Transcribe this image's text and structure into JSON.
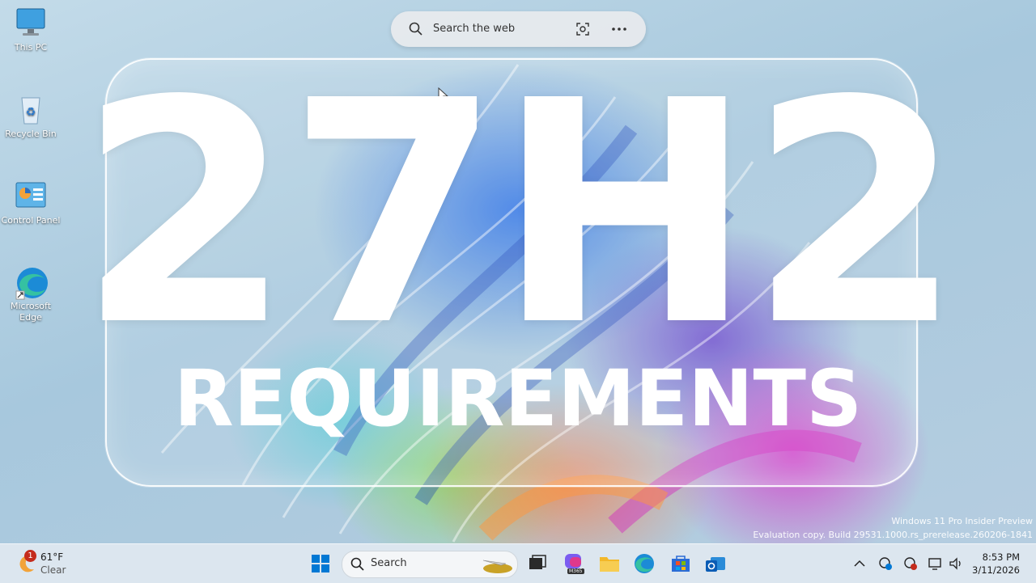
{
  "desktop": {
    "icons": [
      {
        "label": "This PC"
      },
      {
        "label": "Recycle Bin"
      },
      {
        "label": "Control Panel"
      },
      {
        "label": "Microsoft Edge"
      }
    ]
  },
  "search_box": {
    "placeholder": "Search the web"
  },
  "thumbnail": {
    "headline": "27H2",
    "subline": "REQUIREMENTS"
  },
  "watermark": {
    "line1": "Windows 11 Pro Insider Preview",
    "line2": "Evaluation copy. Build 29531.1000.rs_prerelease.260206-1841"
  },
  "taskbar": {
    "weather": {
      "temp": "61°F",
      "condition": "Clear",
      "badge": "1"
    },
    "search_label": "Search",
    "m365_label": "M365",
    "clock": {
      "time": "8:53 PM",
      "date": "3/11/2026"
    }
  },
  "colors": {
    "taskbar_bg": "#dee7ef",
    "windows_blue": "#0078d4",
    "headline": "#ffffff"
  }
}
